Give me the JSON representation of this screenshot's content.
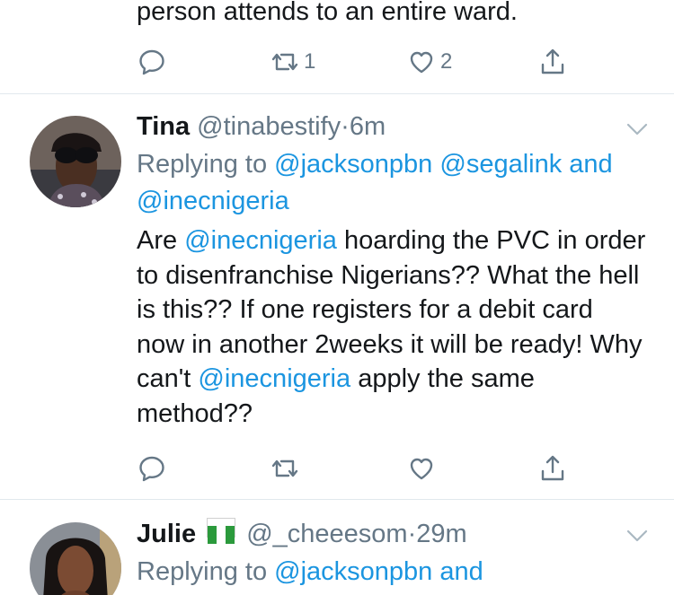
{
  "tweet0": {
    "text_tail": "person attends to an entire ward.",
    "retweet_count": "1",
    "like_count": "2"
  },
  "tweet1": {
    "name": "Tina",
    "handle": "@tinabestify",
    "dot": "·",
    "time": "6m",
    "replying_prefix": "Replying to",
    "reply_handle_1": "@jacksonpbn",
    "reply_handle_2": "@segalink",
    "reply_and": "and",
    "reply_handle_3": "@inecnigeria",
    "body_1": "Are",
    "body_mention_1": "@inecnigeria",
    "body_2": "hoarding the PVC in order to disenfranchise Nigerians?? What the hell is this?? If one registers for a debit card now in another 2weeks it will be ready! Why can't",
    "body_mention_2": "@inecnigeria",
    "body_3": "apply the same method??"
  },
  "tweet2": {
    "name": "Julie",
    "handle": "@_cheeesom",
    "dot": "·",
    "time": "29m",
    "replying_prefix": "Replying to",
    "reply_handle_1": "@jacksonpbn",
    "reply_and": "and"
  },
  "icons": [
    "reply-icon",
    "retweet-icon",
    "like-icon",
    "share-icon",
    "caret-down-icon",
    "nigeria-flag-icon"
  ],
  "colors": {
    "link": "#1b95e0",
    "muted": "#657786",
    "text": "#14171a",
    "divider": "#e1e8ed"
  }
}
